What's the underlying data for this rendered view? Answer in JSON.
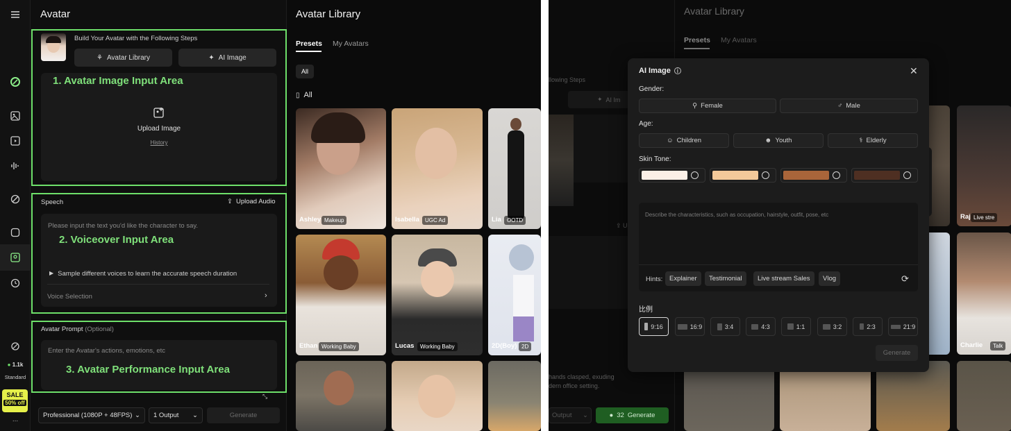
{
  "left_screen": {
    "panel_title": "Avatar",
    "steps_heading": "Build Your Avatar with the Following Steps",
    "btn_avatar_library": "Avatar Library",
    "btn_ai_image": "AI Image",
    "area1_label": "1. Avatar Image Input Area",
    "upload_image": "Upload Image",
    "history": "History",
    "speech_title": "Speech",
    "upload_audio": "Upload Audio",
    "speech_placeholder": "Please input the text you'd like the character to say.",
    "area2_label": "2. Voiceover Input Area",
    "sample_voices": "Sample different voices to learn the accurate speech duration",
    "voice_selection": "Voice Selection",
    "prompt_title": "Avatar Prompt",
    "prompt_optional": "(Optional)",
    "prompt_placeholder": "Enter the Avatar's actions, emotions, etc",
    "area3_label": "3. Avatar Performance Input Area",
    "quality_select": "Professional (1080P + 48FPS)",
    "output_select": "1 Output",
    "generate": "Generate",
    "rail": {
      "credits": "1.1k",
      "plan": "Standard",
      "sale": "SALE",
      "sale_off": "50% off",
      "more": "..."
    },
    "library": {
      "title": "Avatar Library",
      "tab_presets": "Presets",
      "tab_my_avatars": "My Avatars",
      "filter_all": "All",
      "section_all": "All",
      "tiles": [
        {
          "name": "Ashley",
          "tag": "Makeup"
        },
        {
          "name": "Isabella",
          "tag": "UGC Ad"
        },
        {
          "name": "Lia",
          "tag": "OOTD"
        },
        {
          "name": "Ethan",
          "tag": "Working Baby"
        },
        {
          "name": "Lucas",
          "tag": "Working Baby"
        },
        {
          "name": "2D(Boy)",
          "tag": "2D"
        }
      ]
    }
  },
  "right_screen": {
    "library_title": "Avatar Library",
    "tab_presets": "Presets",
    "tab_my_avatars": "My Avatars",
    "bg_steps_text": "llowing Steps",
    "bg_ai_btn": "AI Im",
    "bg_prompt_line1": "hands clasped, exuding",
    "bg_prompt_line2": "dern office setting.",
    "bg_output": "Output",
    "bg_generate": "Generate",
    "bg_credits": "32",
    "bg_tiles": [
      {
        "name": "Raj",
        "tag": "Live stre"
      },
      {
        "name": "Charlie",
        "tag": "Talk"
      }
    ],
    "modal": {
      "title": "AI Image",
      "gender_label": "Gender:",
      "gender_options": [
        "Female",
        "Male"
      ],
      "age_label": "Age:",
      "age_options": [
        "Children",
        "Youth",
        "Elderly"
      ],
      "skin_label": "Skin Tone:",
      "skin_colors": [
        "#fbefe6",
        "#f3c99a",
        "#a9653a",
        "#4e2f22"
      ],
      "desc_placeholder": "Describe the characteristics, such as occupation, hairstyle, outfit, pose, etc",
      "hints_label": "Hints:",
      "hints": [
        "Explainer",
        "Testimonial",
        "Live stream Sales",
        "Vlog"
      ],
      "ratio_label": "比例",
      "ratios": [
        "9:16",
        "16:9",
        "3:4",
        "4:3",
        "1:1",
        "3:2",
        "2:3",
        "21:9"
      ],
      "selected_ratio": "9:16",
      "generate": "Generate"
    }
  },
  "colors": {
    "accent_green": "#6ee06a",
    "generate_green": "#2e7d32",
    "sale_yellow": "#e6f04a"
  }
}
